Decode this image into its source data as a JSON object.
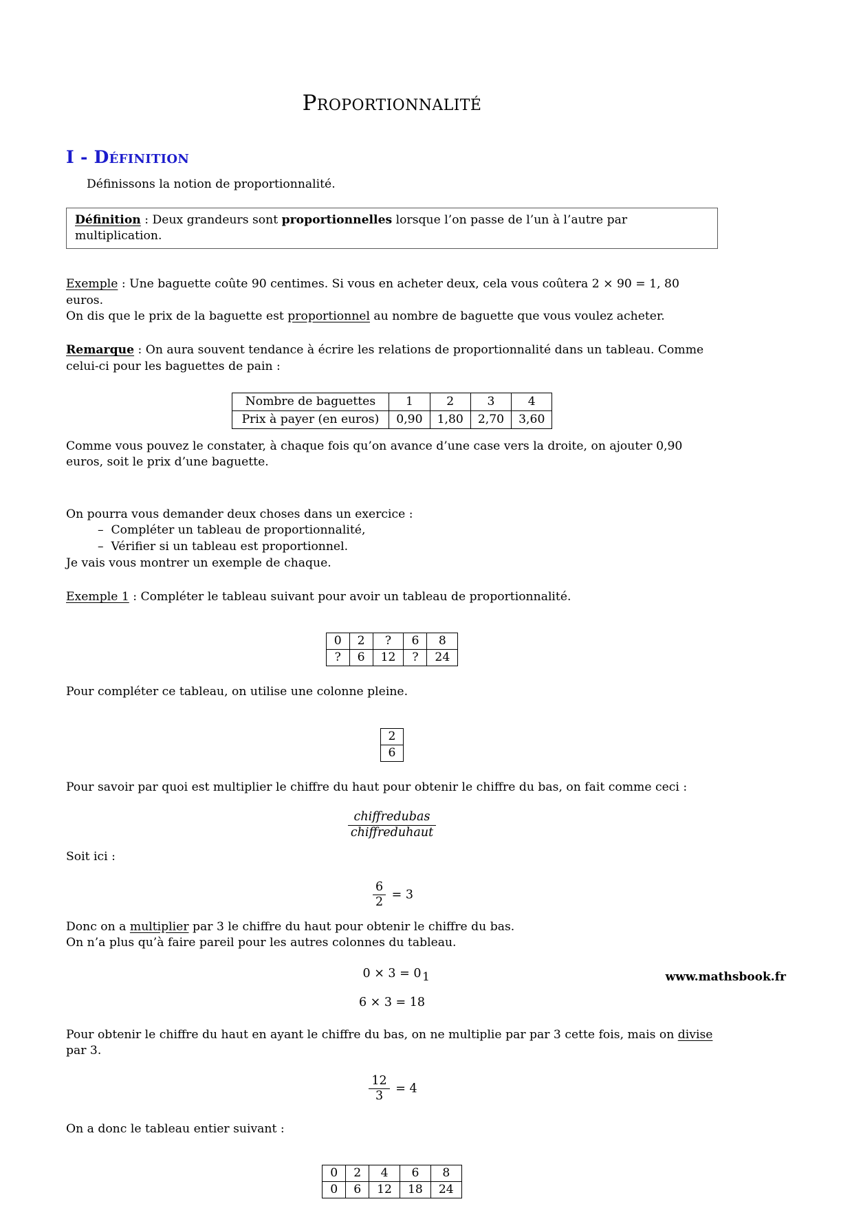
{
  "document": {
    "title": "Proportionnalité",
    "section1": {
      "heading": "I - Définition",
      "intro": "Définissons la notion de proportionnalité.",
      "definition_box": {
        "label": "Définition",
        "separator": " : ",
        "text_before_bold": "Deux grandeurs sont ",
        "bold_word": "proportionnelles",
        "text_after_bold": " lorsque l’on passe de l’un à l’autre par multiplication."
      },
      "exemple": {
        "label": "Exemple",
        "line1": " : Une baguette coûte 90 centimes. Si vous en acheter deux, cela vous coûtera 2 × 90 = 1, 80 euros.",
        "line2_before": "On dis que le prix de la baguette est ",
        "line2_underlined": "proportionnel",
        "line2_after": " au nombre de baguette que vous voulez acheter."
      },
      "remarque": {
        "label": "Remarque",
        "text": " : On aura souvent tendance à écrire les relations de proportionnalité dans un tableau. Comme celui-ci pour les baguettes de pain :"
      },
      "baguette_table": {
        "rows": [
          {
            "label": "Nombre de baguettes",
            "cells": [
              "1",
              "2",
              "3",
              "4"
            ]
          },
          {
            "label": "Prix à payer (en euros)",
            "cells": [
              "0,90",
              "1,80",
              "2,70",
              "3,60"
            ]
          }
        ]
      },
      "after_table_text": "Comme vous pouvez le constater, à chaque fois qu’on avance d’une case vers la droite, on ajouter 0,90 euros, soit le prix d’une baguette.",
      "two_things_intro": "On pourra vous demander deux choses dans un exercice :",
      "two_things_list": [
        "Compléter un tableau de proportionnalité,",
        "Vérifier si un tableau est proportionnel."
      ],
      "two_things_outro": "Je vais vous montrer un exemple de chaque.",
      "exemple1": {
        "label": "Exemple 1",
        "text": " : Compléter le tableau suivant pour avoir un tableau de proportionnalité."
      },
      "incomplete_table": {
        "row_top": [
          "0",
          "2",
          "?",
          "6",
          "8"
        ],
        "row_bottom": [
          "?",
          "6",
          "12",
          "?",
          "24"
        ]
      },
      "use_full_column_text": "Pour compléter ce tableau, on utilise une colonne pleine.",
      "full_column_table": {
        "top": "2",
        "bottom": "6"
      },
      "how_to_find_text": "Pour savoir par quoi est multiplier le chiffre du haut pour obtenir le chiffre du bas, on fait comme ceci :",
      "ratio_formula": {
        "numerator": "chiffredubas",
        "denominator": "chiffreduhaut"
      },
      "soit_ici": "Soit ici :",
      "ratio_example": {
        "numerator": "6",
        "denominator": "2",
        "equals": "= 3"
      },
      "multiply_text_before": "Donc on a ",
      "multiply_underlined": "multiplier",
      "multiply_text_after": " par 3 le chiffre du haut pour obtenir le chiffre du bas.",
      "same_for_others": "On n’a plus qu’à faire pareil pour les autres colonnes du tableau.",
      "computation1": "0 × 3 = 0",
      "computation2": "6 × 3 = 18",
      "divide_text_before": "Pour obtenir le chiffre du haut en ayant le chiffre du bas, on ne multiplie par par 3 cette fois, mais on ",
      "divide_underlined": "divise",
      "divide_text_after": " par 3.",
      "division_example": {
        "numerator": "12",
        "denominator": "3",
        "equals": "= 4"
      },
      "final_table_intro": "On a donc le tableau entier suivant :",
      "complete_table": {
        "row_top": [
          "0",
          "2",
          "4",
          "6",
          "8"
        ],
        "row_bottom": [
          "0",
          "6",
          "12",
          "18",
          "24"
        ]
      }
    },
    "footer": {
      "page_number": "1",
      "website": "www.mathsbook.fr"
    },
    "colors": {
      "heading": "#1c1ccc",
      "text": "#000000",
      "box_border": "#5a5a5a",
      "table_border": "#000000"
    }
  }
}
